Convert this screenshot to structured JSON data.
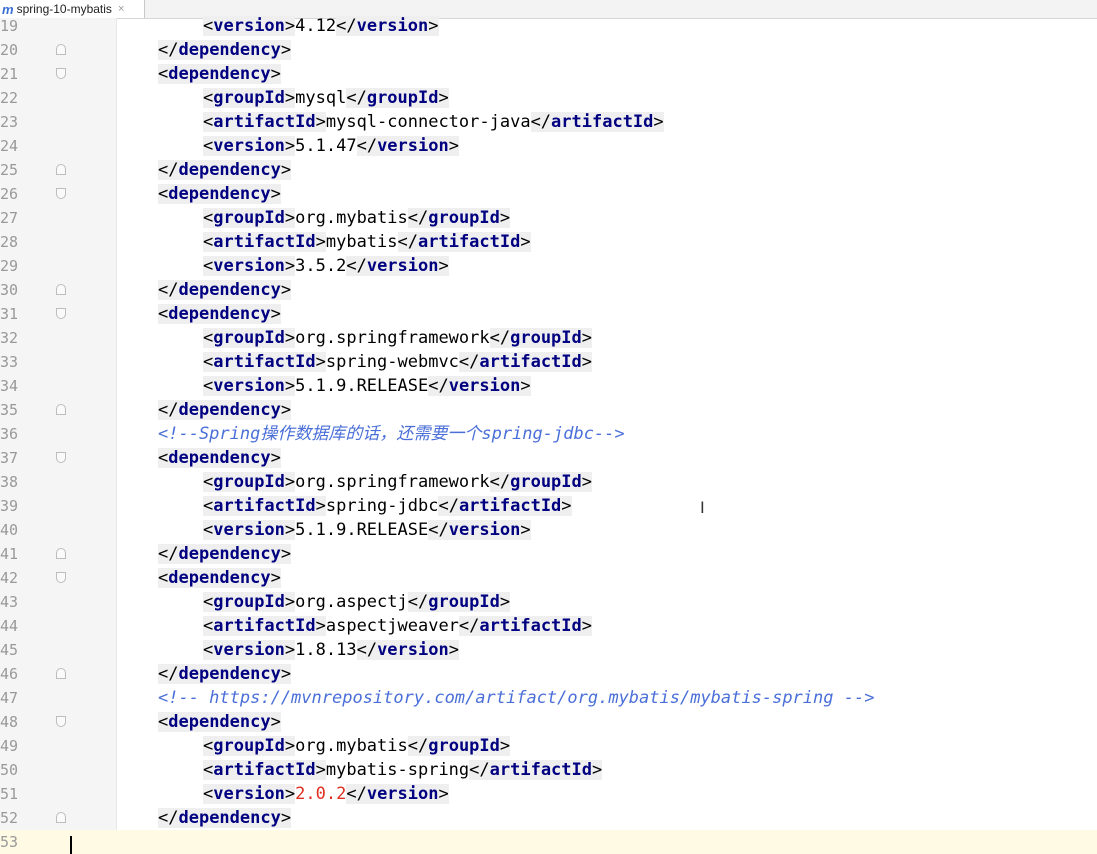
{
  "tab": {
    "icon": "m",
    "title": "spring-10-mybatis",
    "close": "×"
  },
  "lines": [
    {
      "n": "19",
      "indent": 2,
      "fold": "",
      "parts": [
        {
          "t": "tag",
          "v": "version"
        },
        {
          "t": "val",
          "v": "4.12"
        },
        {
          "t": "etag",
          "v": "version"
        }
      ]
    },
    {
      "n": "20",
      "indent": 1,
      "fold": "close",
      "parts": [
        {
          "t": "etag",
          "v": "dependency"
        }
      ]
    },
    {
      "n": "21",
      "indent": 1,
      "fold": "open",
      "parts": [
        {
          "t": "tag",
          "v": "dependency"
        }
      ]
    },
    {
      "n": "22",
      "indent": 2,
      "fold": "",
      "parts": [
        {
          "t": "tag",
          "v": "groupId"
        },
        {
          "t": "val",
          "v": "mysql"
        },
        {
          "t": "etag",
          "v": "groupId"
        }
      ]
    },
    {
      "n": "23",
      "indent": 2,
      "fold": "",
      "parts": [
        {
          "t": "tag",
          "v": "artifactId"
        },
        {
          "t": "val",
          "v": "mysql-connector-java"
        },
        {
          "t": "etag",
          "v": "artifactId"
        }
      ]
    },
    {
      "n": "24",
      "indent": 2,
      "fold": "",
      "parts": [
        {
          "t": "tag",
          "v": "version"
        },
        {
          "t": "val",
          "v": "5.1.47"
        },
        {
          "t": "etag",
          "v": "version"
        }
      ]
    },
    {
      "n": "25",
      "indent": 1,
      "fold": "close",
      "parts": [
        {
          "t": "etag",
          "v": "dependency"
        }
      ]
    },
    {
      "n": "26",
      "indent": 1,
      "fold": "open",
      "parts": [
        {
          "t": "tag",
          "v": "dependency"
        }
      ]
    },
    {
      "n": "27",
      "indent": 2,
      "fold": "",
      "parts": [
        {
          "t": "tag",
          "v": "groupId"
        },
        {
          "t": "val",
          "v": "org.mybatis"
        },
        {
          "t": "etag",
          "v": "groupId"
        }
      ]
    },
    {
      "n": "28",
      "indent": 2,
      "fold": "",
      "parts": [
        {
          "t": "tag",
          "v": "artifactId"
        },
        {
          "t": "val",
          "v": "mybatis"
        },
        {
          "t": "etag",
          "v": "artifactId"
        }
      ]
    },
    {
      "n": "29",
      "indent": 2,
      "fold": "",
      "parts": [
        {
          "t": "tag",
          "v": "version"
        },
        {
          "t": "val",
          "v": "3.5.2"
        },
        {
          "t": "etag",
          "v": "version"
        }
      ]
    },
    {
      "n": "30",
      "indent": 1,
      "fold": "close",
      "parts": [
        {
          "t": "etag",
          "v": "dependency"
        }
      ]
    },
    {
      "n": "31",
      "indent": 1,
      "fold": "open",
      "parts": [
        {
          "t": "tag",
          "v": "dependency"
        }
      ]
    },
    {
      "n": "32",
      "indent": 2,
      "fold": "",
      "parts": [
        {
          "t": "tag",
          "v": "groupId"
        },
        {
          "t": "val",
          "v": "org.springframework"
        },
        {
          "t": "etag",
          "v": "groupId"
        }
      ]
    },
    {
      "n": "33",
      "indent": 2,
      "fold": "",
      "parts": [
        {
          "t": "tag",
          "v": "artifactId"
        },
        {
          "t": "val",
          "v": "spring-webmvc"
        },
        {
          "t": "etag",
          "v": "artifactId"
        }
      ]
    },
    {
      "n": "34",
      "indent": 2,
      "fold": "",
      "parts": [
        {
          "t": "tag",
          "v": "version"
        },
        {
          "t": "val",
          "v": "5.1.9.RELEASE"
        },
        {
          "t": "etag",
          "v": "version"
        }
      ]
    },
    {
      "n": "35",
      "indent": 1,
      "fold": "close",
      "parts": [
        {
          "t": "etag",
          "v": "dependency"
        }
      ]
    },
    {
      "n": "36",
      "indent": 1,
      "fold": "",
      "parts": [
        {
          "t": "cmt",
          "v": "<!--Spring操作数据库的话，还需要一个spring-jdbc-->"
        }
      ]
    },
    {
      "n": "37",
      "indent": 1,
      "fold": "open",
      "parts": [
        {
          "t": "tag",
          "v": "dependency"
        }
      ]
    },
    {
      "n": "38",
      "indent": 2,
      "fold": "",
      "parts": [
        {
          "t": "tag",
          "v": "groupId"
        },
        {
          "t": "val",
          "v": "org.springframework"
        },
        {
          "t": "etag",
          "v": "groupId"
        }
      ]
    },
    {
      "n": "39",
      "indent": 2,
      "fold": "",
      "parts": [
        {
          "t": "tag",
          "v": "artifactId"
        },
        {
          "t": "val",
          "v": "spring-jdbc"
        },
        {
          "t": "etag",
          "v": "artifactId"
        }
      ]
    },
    {
      "n": "40",
      "indent": 2,
      "fold": "",
      "parts": [
        {
          "t": "tag",
          "v": "version"
        },
        {
          "t": "val",
          "v": "5.1.9.RELEASE"
        },
        {
          "t": "etag",
          "v": "version"
        }
      ]
    },
    {
      "n": "41",
      "indent": 1,
      "fold": "close",
      "parts": [
        {
          "t": "etag",
          "v": "dependency"
        }
      ]
    },
    {
      "n": "42",
      "indent": 1,
      "fold": "open",
      "parts": [
        {
          "t": "tag",
          "v": "dependency"
        }
      ]
    },
    {
      "n": "43",
      "indent": 2,
      "fold": "",
      "parts": [
        {
          "t": "tag",
          "v": "groupId"
        },
        {
          "t": "val",
          "v": "org.aspectj"
        },
        {
          "t": "etag",
          "v": "groupId"
        }
      ]
    },
    {
      "n": "44",
      "indent": 2,
      "fold": "",
      "parts": [
        {
          "t": "tag",
          "v": "artifactId"
        },
        {
          "t": "val",
          "v": "aspectjweaver"
        },
        {
          "t": "etag",
          "v": "artifactId"
        }
      ]
    },
    {
      "n": "45",
      "indent": 2,
      "fold": "",
      "parts": [
        {
          "t": "tag",
          "v": "version"
        },
        {
          "t": "val",
          "v": "1.8.13"
        },
        {
          "t": "etag",
          "v": "version"
        }
      ]
    },
    {
      "n": "46",
      "indent": 1,
      "fold": "close",
      "parts": [
        {
          "t": "etag",
          "v": "dependency"
        }
      ]
    },
    {
      "n": "47",
      "indent": 1,
      "fold": "",
      "parts": [
        {
          "t": "cmt",
          "v": "<!-- https://mvnrepository.com/artifact/org.mybatis/mybatis-spring -->"
        }
      ]
    },
    {
      "n": "48",
      "indent": 1,
      "fold": "open",
      "parts": [
        {
          "t": "tag",
          "v": "dependency"
        }
      ]
    },
    {
      "n": "49",
      "indent": 2,
      "fold": "",
      "parts": [
        {
          "t": "tag",
          "v": "groupId"
        },
        {
          "t": "val",
          "v": "org.mybatis"
        },
        {
          "t": "etag",
          "v": "groupId"
        }
      ]
    },
    {
      "n": "50",
      "indent": 2,
      "fold": "",
      "parts": [
        {
          "t": "tag",
          "v": "artifactId"
        },
        {
          "t": "val",
          "v": "mybatis-spring"
        },
        {
          "t": "etag",
          "v": "artifactId"
        }
      ]
    },
    {
      "n": "51",
      "indent": 2,
      "fold": "",
      "parts": [
        {
          "t": "tag",
          "v": "version"
        },
        {
          "t": "num",
          "v": "2.0.2"
        },
        {
          "t": "etag",
          "v": "version"
        }
      ]
    },
    {
      "n": "52",
      "indent": 1,
      "fold": "close",
      "parts": [
        {
          "t": "etag",
          "v": "dependency"
        }
      ]
    },
    {
      "n": "53",
      "indent": 0,
      "fold": "",
      "current": true,
      "parts": []
    }
  ]
}
